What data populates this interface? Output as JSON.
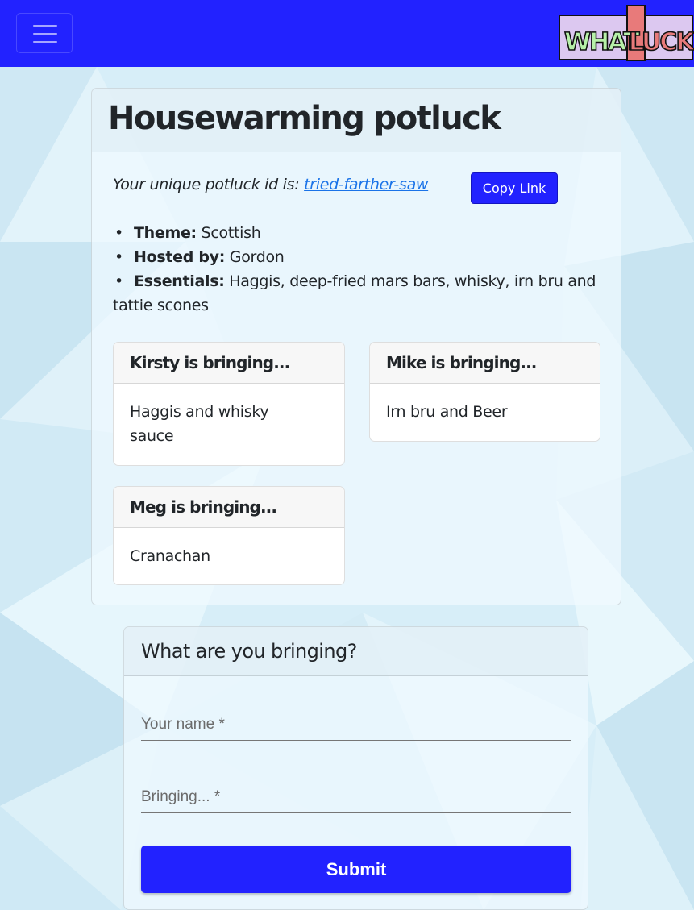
{
  "navbar": {
    "menu_icon": "hamburger-menu-icon",
    "logo": {
      "text_left": "WHAT",
      "text_right": "LUCK"
    },
    "color": "#2222ff"
  },
  "potluck": {
    "title": "Housewarming potluck",
    "id_prefix": "Your unique potluck id is:",
    "id_value": "tried-farther-saw",
    "copy_label": "Copy Link",
    "details": [
      {
        "key": "Theme:",
        "value": "Scottish"
      },
      {
        "key": "Hosted by:",
        "value": "Gordon"
      },
      {
        "key": "Essentials:",
        "value": "Haggis, deep-fried mars bars, whisky, irn bru and tattie scones"
      }
    ],
    "bringing": [
      {
        "header": "Kirsty is bringing...",
        "item": "Haggis and whisky sauce"
      },
      {
        "header": "Mike is bringing...",
        "item": "Irn bru and Beer"
      },
      {
        "header": "Meg is bringing...",
        "item": "Cranachan"
      }
    ]
  },
  "form": {
    "title": "What are you bringing?",
    "name_placeholder": "Your name *",
    "bringing_placeholder": "Bringing... *",
    "submit_label": "Submit"
  }
}
